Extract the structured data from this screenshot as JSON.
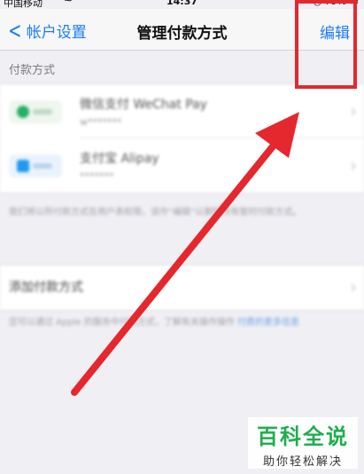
{
  "status_bar": {
    "carrier": "中国移动",
    "time": "14:37",
    "battery": "79%"
  },
  "navbar": {
    "back_label": "帐户设置",
    "title": "管理付款方式",
    "edit_label": "编辑"
  },
  "payment_section": {
    "header": "付款方式",
    "methods": [
      {
        "name": "微信支付 WeChat Pay",
        "account": "w*******"
      },
      {
        "name": "支付宝 Alipay",
        "account": "*******"
      }
    ],
    "note": "我们将以所付款方式在用户表权限，该作“编辑”以删除所有暂时付款方式。"
  },
  "add_section": {
    "label": "添加付款方式",
    "note_text": "您可以通过 Apple 的服务中付款方式，了解有关操作操作",
    "note_link": "付费的更多信息"
  },
  "colors": {
    "accent": "#1a7cf5",
    "annotation": "#e4282d",
    "watermark": "#1fae4d"
  },
  "watermark": {
    "title": "百科全说",
    "subtitle": "助你轻松解决"
  }
}
